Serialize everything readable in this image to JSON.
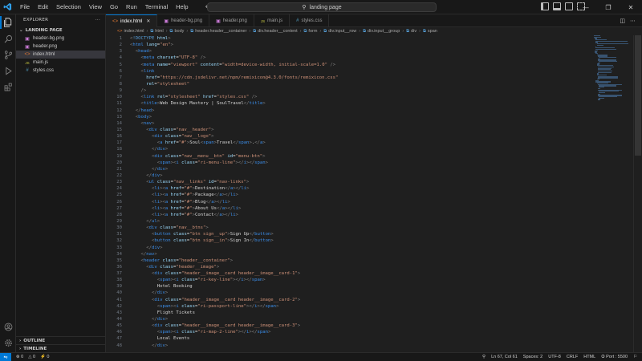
{
  "titlebar": {
    "menus": [
      "File",
      "Edit",
      "Selection",
      "View",
      "Go",
      "Run",
      "Terminal",
      "Help"
    ],
    "command_center": "landing page",
    "back_icon": "arrow-left-icon",
    "forward_icon": "arrow-right-icon"
  },
  "sidebar": {
    "title": "EXPLORER",
    "more": "···",
    "folder": "LANDING PAGE",
    "files": [
      {
        "name": "header-bg.png",
        "icon": "image-file-icon",
        "color": "#c97ad6"
      },
      {
        "name": "header.png",
        "icon": "image-file-icon",
        "color": "#c97ad6"
      },
      {
        "name": "index.html",
        "icon": "html-file-icon",
        "color": "#e37933"
      },
      {
        "name": "main.js",
        "icon": "js-file-icon",
        "color": "#cbcb41"
      },
      {
        "name": "styles.css",
        "icon": "css-file-icon",
        "color": "#519aba"
      }
    ],
    "outline": "OUTLINE",
    "timeline": "TIMELINE"
  },
  "tabs": [
    {
      "name": "index.html",
      "active": true
    },
    {
      "name": "header-bg.png",
      "active": false
    },
    {
      "name": "header.png",
      "active": false
    },
    {
      "name": "main.js",
      "active": false
    },
    {
      "name": "styles.css",
      "active": false
    }
  ],
  "breadcrumb": [
    "index.html",
    "html",
    "body",
    "header.header__container",
    "div.header__content",
    "form",
    "div.input__row",
    "div.input__group",
    "div",
    "span"
  ],
  "code": {
    "lines": [
      "<!DOCTYPE html>",
      "<html lang=\"en\">",
      "  <head>",
      "    <meta charset=\"UTF-8\" />",
      "    <meta name=\"viewport\" content=\"width=device-width, initial-scale=1.0\" />",
      "    <link",
      "      href=\"https://cdn.jsdelivr.net/npm/remixicon@4.3.0/fonts/remixicon.css\"",
      "      rel=\"stylesheet\"",
      "    />",
      "    <link rel=\"stylesheet\" href=\"styles.css\" />",
      "    <title>Web Design Mastery | SoulTravel</title>",
      "  </head>",
      "  <body>",
      "    <nav>",
      "      <div class=\"nav__header\">",
      "        <div class=\"nav__logo\">",
      "          <a href=\"#\">Soul<span>Travel</span>.</a>",
      "        </div>",
      "        <div class=\"nav__menu__btn\" id=\"menu-btn\">",
      "          <span><i class=\"ri-menu-line\"></i></span>",
      "        </div>",
      "      </div>",
      "      <ul class=\"nav__links\" id=\"nav-links\">",
      "        <li><a href=\"#\">Destination</a></li>",
      "        <li><a href=\"#\">Package</a></li>",
      "        <li><a href=\"#\">Blog</a></li>",
      "        <li><a href=\"#\">About Us</a></li>",
      "        <li><a href=\"#\">Contact</a></li>",
      "      </ul>",
      "      <div class=\"nav__btns\">",
      "        <button class=\"btn sign__up\">Sign Up</button>",
      "        <button class=\"btn sign__in\">Sign In</button>",
      "      </div>",
      "    </nav>",
      "    <header class=\"header__container\">",
      "      <div class=\"header__image\">",
      "        <div class=\"header__image__card header__image__card-1\">",
      "          <span><i class=\"ri-key-line\"></i></span>",
      "          Hotel Booking",
      "        </div>",
      "        <div class=\"header__image__card header__image__card-2\">",
      "          <span><i class=\"ri-passport-line\"></i></span>",
      "          Flight Tickets",
      "        </div>",
      "        <div class=\"header__image__card header__image__card-3\">",
      "          <span><i class=\"ri-map-2-line\"></i></span>",
      "          Local Events",
      "        </div>"
    ]
  },
  "statusbar": {
    "errors": "0",
    "warnings": "0",
    "info": "0",
    "position": "Ln 67, Col 61",
    "spaces": "Spaces: 2",
    "encoding": "UTF-8",
    "eol": "CRLF",
    "language": "HTML",
    "port": "Port : 5500"
  },
  "colors": {
    "accent": "#0078d4",
    "tag": "#3b8eea",
    "attribute": "#9cdcfe",
    "string": "#ce9178"
  }
}
